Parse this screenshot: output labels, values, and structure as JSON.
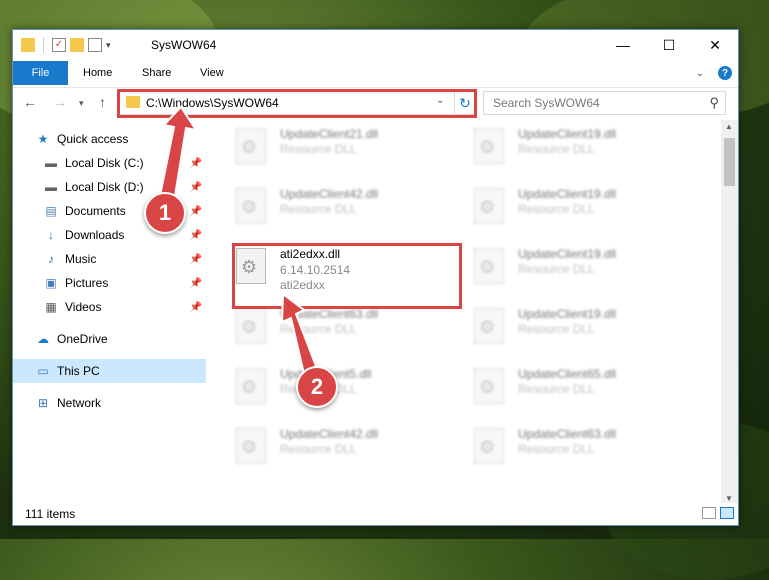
{
  "window": {
    "title": "SysWOW64"
  },
  "ribbon": {
    "file": "File",
    "tabs": [
      "Home",
      "Share",
      "View"
    ]
  },
  "address": {
    "path": "C:\\Windows\\SysWOW64"
  },
  "search": {
    "placeholder": "Search SysWOW64"
  },
  "sidebar": {
    "items": [
      {
        "label": "Quick access",
        "icon": "star-icon"
      },
      {
        "label": "Local Disk (C:)",
        "icon": "drive-icon",
        "pinned": true
      },
      {
        "label": "Local Disk (D:)",
        "icon": "drive-icon",
        "pinned": true
      },
      {
        "label": "Documents",
        "icon": "documents-icon",
        "pinned": true
      },
      {
        "label": "Downloads",
        "icon": "download-icon",
        "pinned": true
      },
      {
        "label": "Music",
        "icon": "music-icon",
        "pinned": true
      },
      {
        "label": "Pictures",
        "icon": "pictures-icon",
        "pinned": true
      },
      {
        "label": "Videos",
        "icon": "videos-icon",
        "pinned": true
      },
      {
        "label": "OneDrive",
        "icon": "cloud-icon"
      },
      {
        "label": "This PC",
        "icon": "computer-icon",
        "selected": true
      },
      {
        "label": "Network",
        "icon": "network-icon"
      }
    ]
  },
  "files": [
    {
      "name": "UpdateClient21.dll",
      "line1": "Resource DLL",
      "line2": ""
    },
    {
      "name": "UpdateClient19.dll",
      "line1": "Resource DLL",
      "line2": ""
    },
    {
      "name": "UpdateClient42.dll",
      "line1": "Resource DLL",
      "line2": ""
    },
    {
      "name": "UpdateClient19.dll",
      "line1": "Resource DLL",
      "line2": ""
    },
    {
      "name": "ati2edxx.dll",
      "line1": "6.14.10.2514",
      "line2": "ati2edxx"
    },
    {
      "name": "UpdateClient19.dll",
      "line1": "Resource DLL",
      "line2": ""
    },
    {
      "name": "UpdateClient63.dll",
      "line1": "Resource DLL",
      "line2": ""
    },
    {
      "name": "UpdateClient19.dll",
      "line1": "Resource DLL",
      "line2": ""
    },
    {
      "name": "UpdateClient5.dll",
      "line1": "Resource DLL",
      "line2": ""
    },
    {
      "name": "UpdateClient65.dll",
      "line1": "Resource DLL",
      "line2": ""
    },
    {
      "name": "UpdateClient42.dll",
      "line1": "Resource DLL",
      "line2": ""
    },
    {
      "name": "UpdateClient63.dll",
      "line1": "Resource DLL",
      "line2": ""
    }
  ],
  "status": {
    "items": "111 items"
  },
  "callouts": [
    "1",
    "2"
  ],
  "colors": {
    "accent": "#1979ca",
    "highlight": "#d94545",
    "selected": "#cce8ff"
  }
}
